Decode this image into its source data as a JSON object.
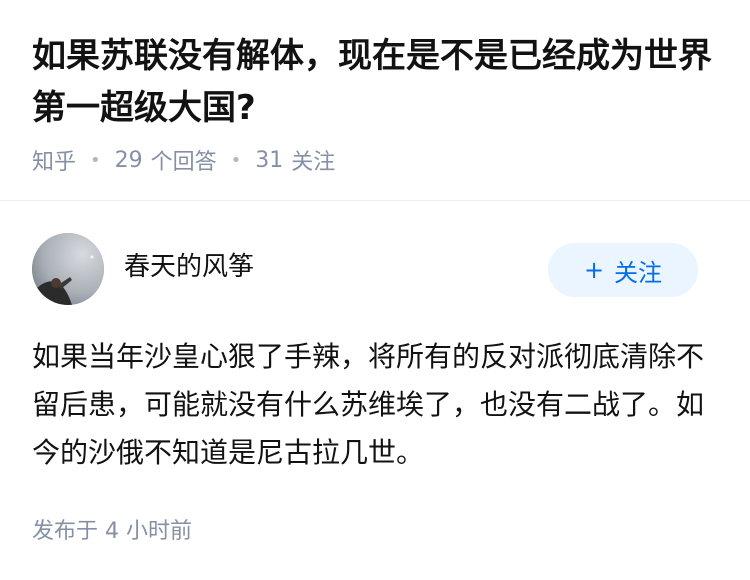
{
  "question": {
    "title": "如果苏联没有解体，现在是不是已经成为世界第一超级大国?",
    "source": "知乎",
    "answers_count": "29",
    "answers_label": "个回答",
    "followers_count": "31",
    "followers_label": "关注"
  },
  "answer": {
    "author_name": "春天的风筝",
    "avatar_icon": "user-avatar",
    "follow_label": "关注",
    "follow_icon": "plus-icon",
    "content": "如果当年沙皇心狠了手辣，将所有的反对派彻底清除不留后患，可能就没有什么苏维埃了，也没有二战了。如今的沙俄不知道是尼古拉几世。",
    "published_label": "发布于",
    "published_time": "4 小时前"
  },
  "colors": {
    "accent": "#056de8",
    "follow_bg": "#ebf5ff",
    "meta_text": "#8590a6",
    "title_text": "#121212"
  }
}
